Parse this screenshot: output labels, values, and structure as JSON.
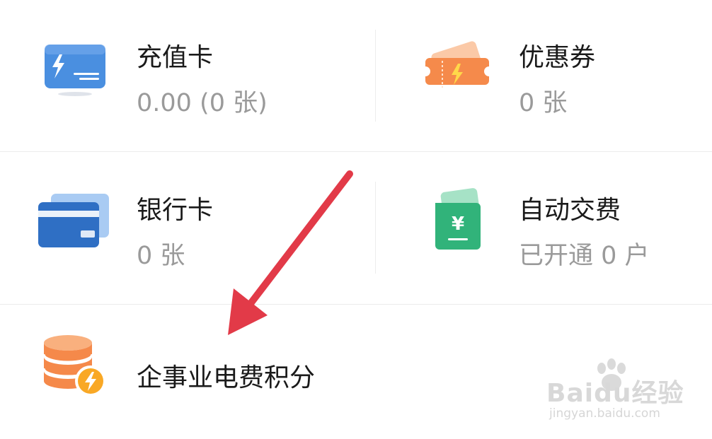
{
  "tiles": {
    "recharge_card": {
      "title": "充值卡",
      "subtitle": "0.00 (0 张)"
    },
    "coupon": {
      "title": "优惠券",
      "subtitle": "0 张"
    },
    "bank_card": {
      "title": "银行卡",
      "subtitle": "0 张"
    },
    "auto_pay": {
      "title": "自动交费",
      "subtitle": "已开通 0 户"
    },
    "enterprise_points": {
      "title": "企事业电费积分"
    }
  },
  "watermark": {
    "brand": "Baidu经验",
    "url": "jingyan.baidu.com"
  },
  "colors": {
    "recharge_icon": "#4a8fe0",
    "coupon_icon": "#f58a4b",
    "bank_icon": "#2f6fc4",
    "auto_pay_icon": "#31b37a",
    "points_icon": "#f5894a",
    "arrow": "#e23a48"
  },
  "icons": {
    "recharge_card": "lightning-card-icon",
    "coupon": "lightning-ticket-icon",
    "bank_card": "bank-card-icon",
    "auto_pay": "yuan-wallet-icon",
    "enterprise_points": "coin-stack-lightning-icon"
  }
}
